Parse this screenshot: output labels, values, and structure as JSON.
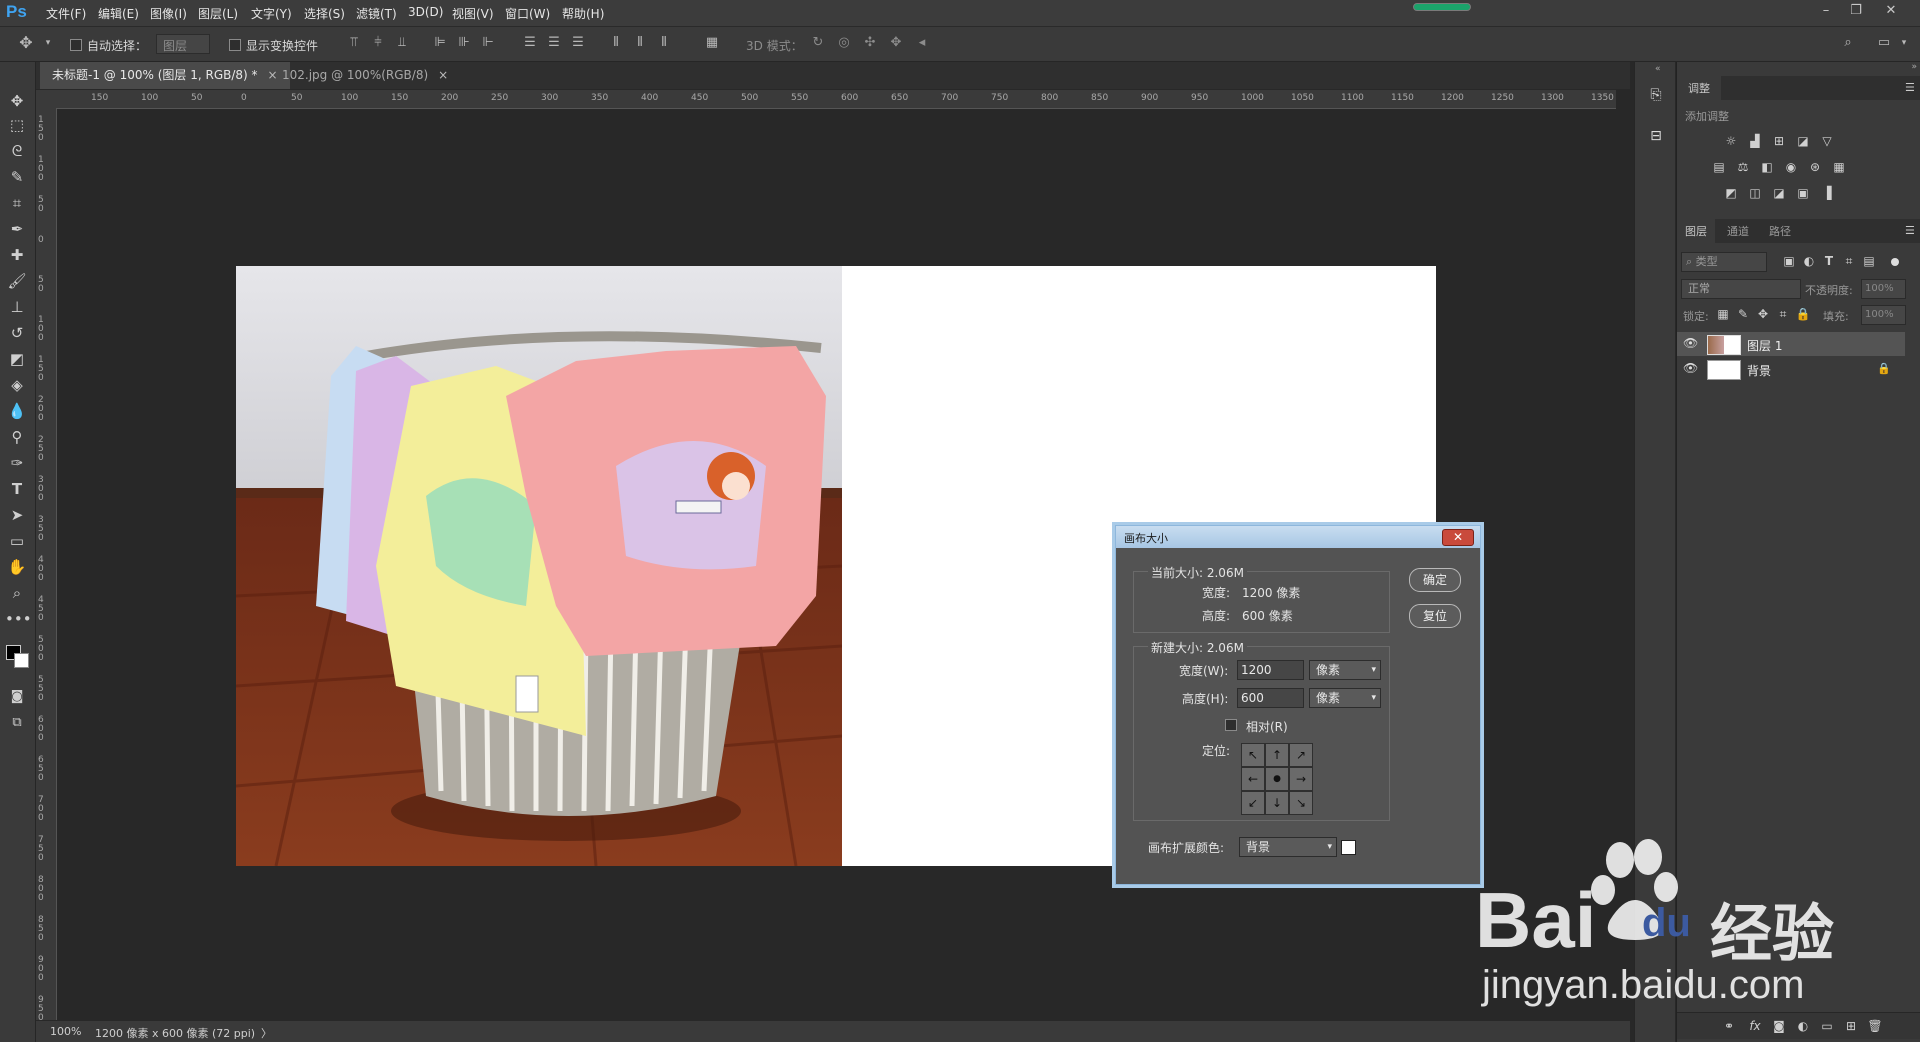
{
  "app": {
    "logo": "Ps"
  },
  "menu": {
    "items": [
      "文件(F)",
      "编辑(E)",
      "图像(I)",
      "图层(L)",
      "文字(Y)",
      "选择(S)",
      "滤镜(T)",
      "3D(D)",
      "视图(V)",
      "窗口(W)",
      "帮助(H)"
    ]
  },
  "window_controls": {
    "minimize": "–",
    "restore": "❐",
    "close": "✕"
  },
  "options": {
    "auto_select_label": "自动选择：",
    "auto_select_value": "图层",
    "show_transform_label": "显示变换控件",
    "mode_3d_label": "3D 模式："
  },
  "tabs": [
    {
      "label": "未标题-1 @ 100% (图层 1, RGB/8) *",
      "close": "×"
    },
    {
      "label": "102.jpg @ 100%(RGB/8)",
      "close": "×"
    }
  ],
  "ruler": {
    "h_labels": [
      "150",
      "100",
      "50",
      "0",
      "50",
      "100",
      "150",
      "200",
      "250",
      "300",
      "350",
      "400",
      "450",
      "500",
      "550",
      "600",
      "650",
      "700",
      "750",
      "800",
      "850",
      "900",
      "950",
      "1000",
      "1050",
      "1100",
      "1150",
      "1200",
      "1250",
      "1300",
      "1350"
    ],
    "v_labels": [
      "150",
      "100",
      "50",
      "0",
      "50",
      "100",
      "150",
      "200",
      "250",
      "300",
      "350",
      "400",
      "450",
      "500",
      "550",
      "600",
      "650",
      "700",
      "750",
      "800",
      "850",
      "900",
      "950"
    ]
  },
  "status": {
    "zoom": "100%",
    "doc_info": "1200 像素 x 600 像素 (72 ppi)",
    "arrow": "〉"
  },
  "panels": {
    "adjustments_tab": "调整",
    "add_adjustment": "添加调整",
    "layers_tabs": [
      "图层",
      "通道",
      "路径"
    ],
    "filter_kind": "类型",
    "blend_mode": "正常",
    "opacity_label": "不透明度:",
    "opacity_value": "100%",
    "lock_label": "锁定:",
    "fill_label": "填充:",
    "fill_value": "100%",
    "layers": [
      {
        "name": "图层 1"
      },
      {
        "name": "背景"
      }
    ]
  },
  "dialog": {
    "title": "画布大小",
    "close": "✕",
    "current_size_label": "当前大小: 2.06M",
    "current_width_label": "宽度:",
    "current_width_value": "1200 像素",
    "current_height_label": "高度:",
    "current_height_value": "600 像素",
    "new_size_label": "新建大小: 2.06M",
    "width_label": "宽度(W):",
    "width_value": "1200",
    "width_unit": "像素",
    "height_label": "高度(H):",
    "height_value": "600",
    "height_unit": "像素",
    "relative_label": "相对(R)",
    "anchor_label": "定位:",
    "anchor_glyphs": [
      "↖",
      "↑",
      "↗",
      "←",
      "●",
      "→",
      "↙",
      "↓",
      "↘"
    ],
    "ext_color_label": "画布扩展颜色:",
    "ext_color_value": "背景",
    "ok_label": "确定",
    "reset_label": "复位"
  },
  "watermark": {
    "brand": "Bai",
    "brand_du": "du",
    "cn": "经验",
    "url": "jingyan.baidu.com"
  },
  "colors": {
    "accent": "#3fa3f0",
    "progress": "#1ba36b",
    "dialog_title": "#b8d2ea",
    "dialog_close": "#c94a3c"
  }
}
